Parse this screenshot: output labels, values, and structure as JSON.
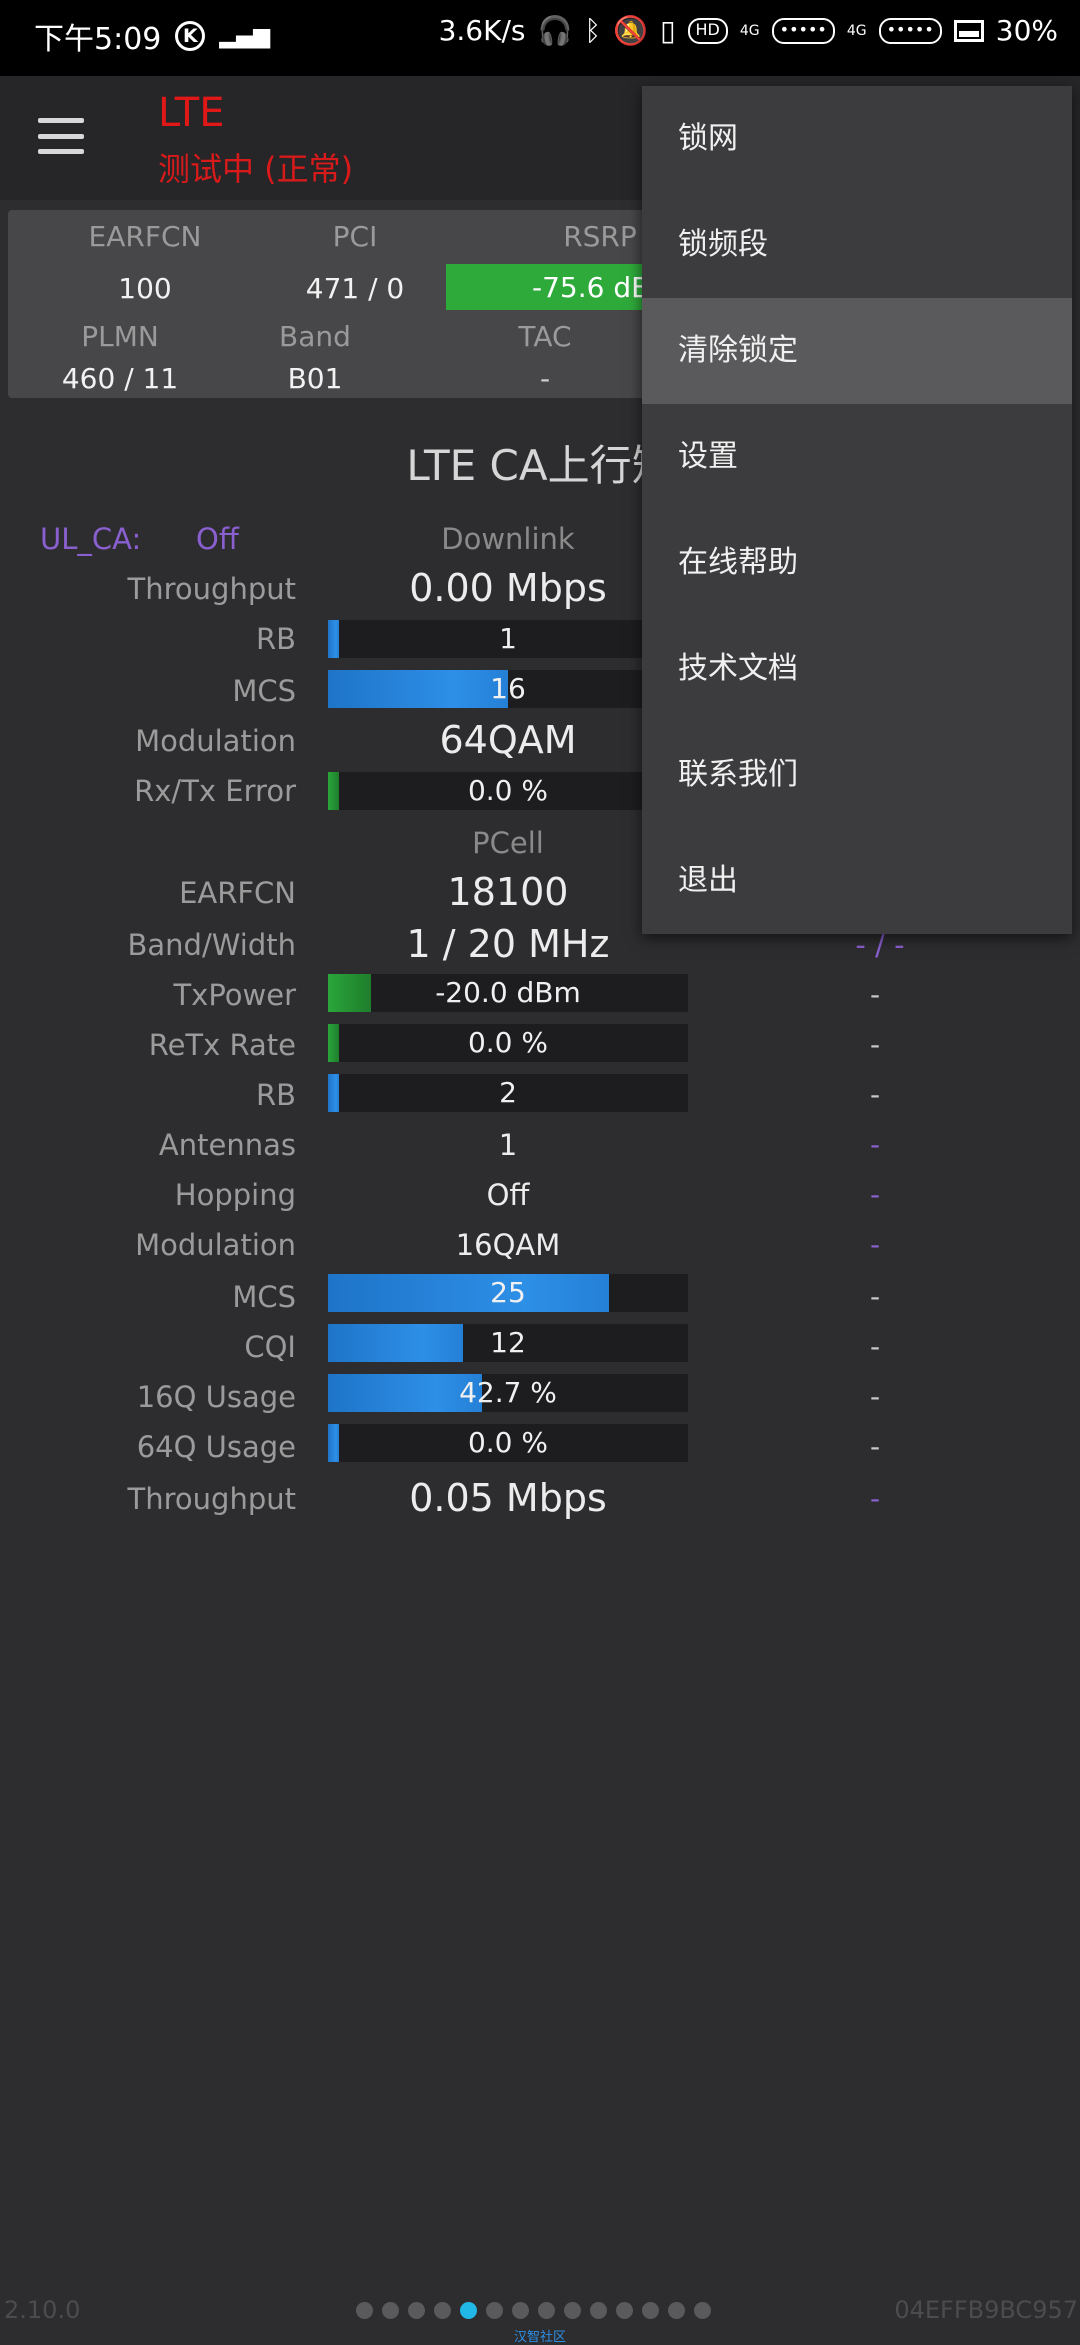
{
  "status_bar": {
    "time": "下午5:09",
    "speed": "3.6K/s",
    "battery": "30%",
    "icons": [
      "k-circle-icon",
      "signal-small-icon",
      "headphones-icon",
      "bluetooth-icon",
      "mute-icon",
      "vibrate-icon",
      "hd-icon",
      "sim1-signal-icon",
      "sim2-signal-icon",
      "battery-icon"
    ]
  },
  "header": {
    "network_type": "LTE",
    "status": "测试中 (正常)"
  },
  "info_panel": {
    "earfcn_label": "EARFCN",
    "earfcn": "100",
    "pci_label": "PCI",
    "pci": "471 / 0",
    "rsrp_label": "RSRP",
    "rsrp": "-75.6 dB",
    "plmn_label": "PLMN",
    "plmn": "460 / 11",
    "band_label": "Band",
    "band": "B01",
    "tac_label": "TAC",
    "tac": "-"
  },
  "section_title": "LTE CA上行矩",
  "ul_ca": {
    "label": "UL_CA:",
    "value": "Off"
  },
  "downlink": {
    "header": "Downlink",
    "throughput_label": "Throughput",
    "throughput": "0.00 Mbps",
    "rb_label": "RB",
    "rb": "1",
    "rb_fill": 0.03,
    "mcs_label": "MCS",
    "mcs": "16",
    "mcs_fill": 0.5,
    "modulation_label": "Modulation",
    "modulation": "64QAM",
    "error_label": "Rx/Tx Error",
    "error": "0.0 %",
    "error_fill": 0.03
  },
  "pcell": {
    "header": "PCell",
    "earfcn_label": "EARFCN",
    "earfcn": "18100",
    "bandwidth_label": "Band/Width",
    "bandwidth": "1 / 20 MHz",
    "bandwidth_scell": "- / -",
    "txpower_label": "TxPower",
    "txpower": "-20.0 dBm",
    "txpower_fill": 0.12,
    "retx_label": "ReTx Rate",
    "retx": "0.0 %",
    "retx_fill": 0.03,
    "rb_label": "RB",
    "rb": "2",
    "rb_fill": 0.03,
    "antennas_label": "Antennas",
    "antennas": "1",
    "hopping_label": "Hopping",
    "hopping": "Off",
    "modulation_label": "Modulation",
    "modulation": "16QAM",
    "mcs_label": "MCS",
    "mcs": "25",
    "mcs_fill": 0.78,
    "cqi_label": "CQI",
    "cqi": "12",
    "cqi_fill": 0.375,
    "q16_label": "16Q Usage",
    "q16": "42.7 %",
    "q16_fill": 0.427,
    "q64_label": "64Q Usage",
    "q64": "0.0 %",
    "q64_fill": 0.03,
    "throughput_label": "Throughput",
    "throughput": "0.05 Mbps",
    "scell_dash": "-"
  },
  "menu": {
    "items": [
      "锁网",
      "锁频段",
      "清除锁定",
      "设置",
      "在线帮助",
      "技术文档",
      "联系我们",
      "退出"
    ],
    "active_index": 2
  },
  "footer": {
    "version": "2.10.0",
    "device_id": "04EFFB9BC957",
    "page_count": 14,
    "active_page": 4,
    "watermark": "汉智社区"
  },
  "colors": {
    "accent_red": "#e01818",
    "purple": "#8a5fd0",
    "bar_blue": "#2d8fe6",
    "bar_green": "#2aa63a",
    "dot_active": "#21b8e8"
  }
}
